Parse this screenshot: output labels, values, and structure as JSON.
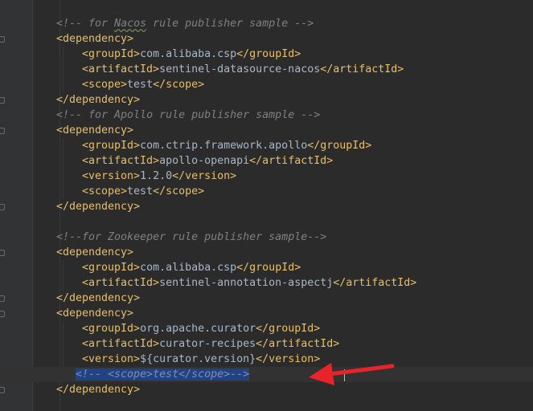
{
  "editor": {
    "lines": [
      {
        "kind": "comment",
        "text": "<!-- for Nacos rule publisher sample -->"
      },
      {
        "kind": "tag",
        "text": "<dependency>"
      },
      {
        "kind": "element",
        "open": "<groupId>",
        "value": "com.alibaba.csp",
        "close": "</groupId>"
      },
      {
        "kind": "element",
        "open": "<artifactId>",
        "value": "sentinel-datasource-nacos",
        "close": "</artifactId>"
      },
      {
        "kind": "element",
        "open": "<scope>",
        "value": "test",
        "close": "</scope>"
      },
      {
        "kind": "tag",
        "text": "</dependency>"
      },
      {
        "kind": "comment",
        "text": "<!-- for Apollo rule publisher sample -->"
      },
      {
        "kind": "tag",
        "text": "<dependency>"
      },
      {
        "kind": "element",
        "open": "<groupId>",
        "value": "com.ctrip.framework.apollo",
        "close": "</groupId>"
      },
      {
        "kind": "element",
        "open": "<artifactId>",
        "value": "apollo-openapi",
        "close": "</artifactId>"
      },
      {
        "kind": "element",
        "open": "<version>",
        "value": "1.2.0",
        "close": "</version>"
      },
      {
        "kind": "element",
        "open": "<scope>",
        "value": "test",
        "close": "</scope>"
      },
      {
        "kind": "tag",
        "text": "</dependency>"
      },
      {
        "kind": "blank",
        "text": ""
      },
      {
        "kind": "comment",
        "text": "<!--for Zookeeper rule publisher sample-->"
      },
      {
        "kind": "tag",
        "text": "<dependency>"
      },
      {
        "kind": "element",
        "open": "<groupId>",
        "value": "com.alibaba.csp",
        "close": "</groupId>"
      },
      {
        "kind": "element",
        "open": "<artifactId>",
        "value": "sentinel-annotation-aspectj",
        "close": "</artifactId>"
      },
      {
        "kind": "tag",
        "text": "</dependency>"
      },
      {
        "kind": "tag",
        "text": "<dependency>"
      },
      {
        "kind": "element",
        "open": "<groupId>",
        "value": "org.apache.curator",
        "close": "</groupId>"
      },
      {
        "kind": "element",
        "open": "<artifactId>",
        "value": "curator-recipes",
        "close": "</artifactId>"
      },
      {
        "kind": "element",
        "open": "<version>",
        "value": "${curator.version}",
        "close": "</version>"
      },
      {
        "kind": "selected-comment",
        "text": "<!-- <scope>test</scope>-->"
      },
      {
        "kind": "tag",
        "text": "</dependency>"
      }
    ]
  },
  "colors": {
    "background": "#2b2b2b",
    "comment": "#808080",
    "tag": "#e8bf6a",
    "text": "#a9b7c6",
    "selection": "#214283",
    "annotation_arrow": "#e8242a"
  }
}
